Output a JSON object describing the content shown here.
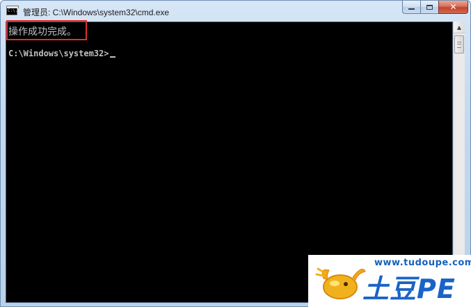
{
  "window": {
    "title": "管理员: C:\\Windows\\system32\\cmd.exe",
    "icon": "cmd-console-icon",
    "icon_label": "C:\\."
  },
  "caption_buttons": {
    "minimize": "minimize-icon",
    "maximize": "maximize-icon",
    "close_label": "✕"
  },
  "console": {
    "message": "操作成功完成。",
    "prompt": "C:\\Windows\\system32>",
    "highlight_color": "#e03030",
    "text_color": "#c0c0c0",
    "background": "#000000"
  },
  "scrollbar": {
    "up_arrow": "▲"
  },
  "watermark": {
    "url": "www.tudoupe.com",
    "brand": "土豆PE",
    "logo": "potato-logo",
    "brand_color": "#1a63c8"
  }
}
